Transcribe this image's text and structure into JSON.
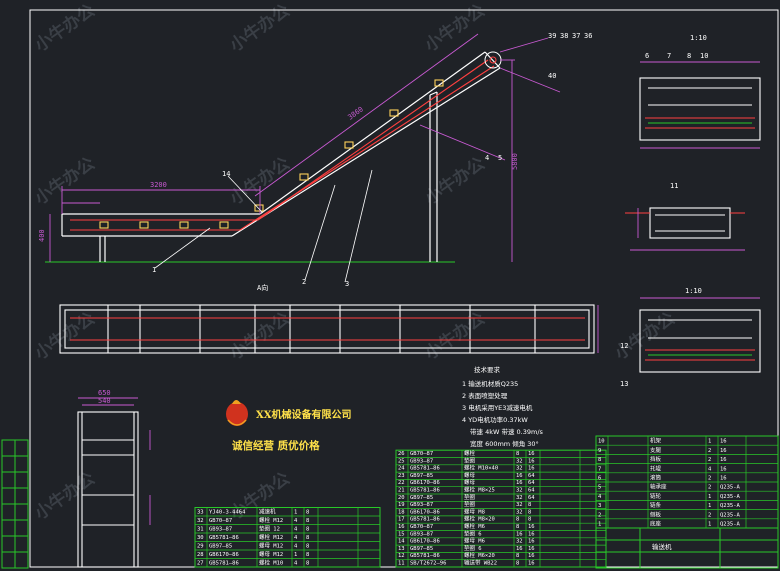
{
  "drawing": {
    "section_labels": {
      "left_view": "A向",
      "right_top": "1:10",
      "right_bottom": "1:10"
    },
    "callouts": [
      "1",
      "2",
      "3",
      "4",
      "5",
      "14",
      "39",
      "38",
      "37",
      "36",
      "40",
      "6",
      "7",
      "8",
      "10",
      "11",
      "12",
      "13",
      "15",
      "16",
      "17",
      "18",
      "19",
      "20",
      "21"
    ],
    "dimensions": {
      "belt_span": "5800",
      "inclined_length": "3860",
      "feed_height": "400",
      "feed_length": "3200",
      "left_width": "650",
      "left_sub": "540"
    },
    "notes": {
      "title": "技术要求",
      "items": [
        "1  输送机材质Q235",
        "2  表面喷塑处理",
        "3  电机采用YE3减速电机",
        "4  YD电机功率0.37kW"
      ],
      "params_line1": "带速 4kW    带速 0.39m/s",
      "params_line2": "宽度 600mm  倾角 30°"
    },
    "logo_company": "XX机械设备有限公司",
    "logo_slogan": "诚信经营  质优价格",
    "watermark": "小牛办公",
    "title_block": {
      "cell_label": "输送机"
    }
  },
  "bom_left": [
    {
      "no": "33",
      "code": "YJ40-3-4464",
      "name": "减速机",
      "qty": "1",
      "mat": "8"
    },
    {
      "no": "32",
      "code": "GB70—87",
      "name": "螺栓 M12",
      "qty": "4",
      "mat": "8"
    },
    {
      "no": "31",
      "code": "GB93—87",
      "name": "垫圈 12",
      "qty": "4",
      "mat": "8"
    },
    {
      "no": "30",
      "code": "GB5781—86",
      "name": "螺栓 M12",
      "qty": "4",
      "mat": "8"
    },
    {
      "no": "29",
      "code": "GB97—85",
      "name": "螺母 M12",
      "qty": "4",
      "mat": "8"
    },
    {
      "no": "28",
      "code": "GB6170—86",
      "name": "螺母 M12",
      "qty": "1",
      "mat": "8"
    },
    {
      "no": "27",
      "code": "GB5781—86",
      "name": "螺栓 M10",
      "qty": "4",
      "mat": "8"
    }
  ],
  "bom_middle": [
    {
      "no": "26",
      "code": "GB70—87",
      "name": "螺栓",
      "qty": "8",
      "mat": "16"
    },
    {
      "no": "25",
      "code": "GB93—87",
      "name": "垫圈",
      "qty": "32",
      "mat": "16"
    },
    {
      "no": "24",
      "code": "GB5781—86",
      "name": "螺栓 M10×40",
      "qty": "32",
      "mat": "16"
    },
    {
      "no": "23",
      "code": "GB97—85",
      "name": "螺母",
      "qty": "16",
      "mat": "64"
    },
    {
      "no": "22",
      "code": "GB6170—86",
      "name": "螺母",
      "qty": "16",
      "mat": "64"
    },
    {
      "no": "21",
      "code": "GB5781—86",
      "name": "螺栓 M8×25",
      "qty": "32",
      "mat": "64"
    },
    {
      "no": "20",
      "code": "GB97—85",
      "name": "垫圈",
      "qty": "32",
      "mat": "64"
    },
    {
      "no": "19",
      "code": "GB93—87",
      "name": "垫圈",
      "qty": "32",
      "mat": "8"
    },
    {
      "no": "18",
      "code": "GB6170—86",
      "name": "螺母 M8",
      "qty": "32",
      "mat": "8"
    },
    {
      "no": "17",
      "code": "GB5781—86",
      "name": "螺栓 M8×20",
      "qty": "8",
      "mat": "8"
    },
    {
      "no": "16",
      "code": "GB70—87",
      "name": "螺栓 M6",
      "qty": "8",
      "mat": "16"
    },
    {
      "no": "15",
      "code": "GB93—87",
      "name": "垫圈 6",
      "qty": "16",
      "mat": "16"
    },
    {
      "no": "14",
      "code": "GB6170—86",
      "name": "螺母 M6",
      "qty": "32",
      "mat": "16"
    },
    {
      "no": "13",
      "code": "GB97—85",
      "name": "垫圈 6",
      "qty": "16",
      "mat": "16"
    },
    {
      "no": "12",
      "code": "GB5781—86",
      "name": "螺栓 M6×20",
      "qty": "8",
      "mat": "16"
    },
    {
      "no": "11",
      "code": "SB/T2672—96",
      "name": "输送带 WB22",
      "qty": "8",
      "mat": "16"
    }
  ],
  "bom_right": [
    {
      "no": "10",
      "name": "机架",
      "qty": "1",
      "mat": "16"
    },
    {
      "no": "9",
      "name": "支腿",
      "qty": "2",
      "mat": "16"
    },
    {
      "no": "8",
      "name": "挡板",
      "qty": "2",
      "mat": "16"
    },
    {
      "no": "7",
      "name": "托辊",
      "qty": "4",
      "mat": "16"
    },
    {
      "no": "6",
      "name": "滚筒",
      "qty": "2",
      "mat": "16"
    },
    {
      "no": "5",
      "name": "轴承座",
      "qty": "2",
      "mat": "Q235-A"
    },
    {
      "no": "4",
      "name": "链轮",
      "qty": "1",
      "mat": "Q235-A"
    },
    {
      "no": "3",
      "name": "链条",
      "qty": "1",
      "mat": "Q235-A"
    },
    {
      "no": "2",
      "name": "侧板",
      "qty": "2",
      "mat": "Q235-A"
    },
    {
      "no": "1",
      "name": "底座",
      "qty": "1",
      "mat": "Q235-A"
    }
  ],
  "colors": {
    "background": "#1f2227",
    "frame": "#ffffff",
    "grid": "#28c828",
    "dim": "#c85ad2",
    "part": "#ff4040",
    "part2": "#ffd25a",
    "text": "#ffffff",
    "yellow": "#ffe14a",
    "watermark": "#3a3f46"
  }
}
